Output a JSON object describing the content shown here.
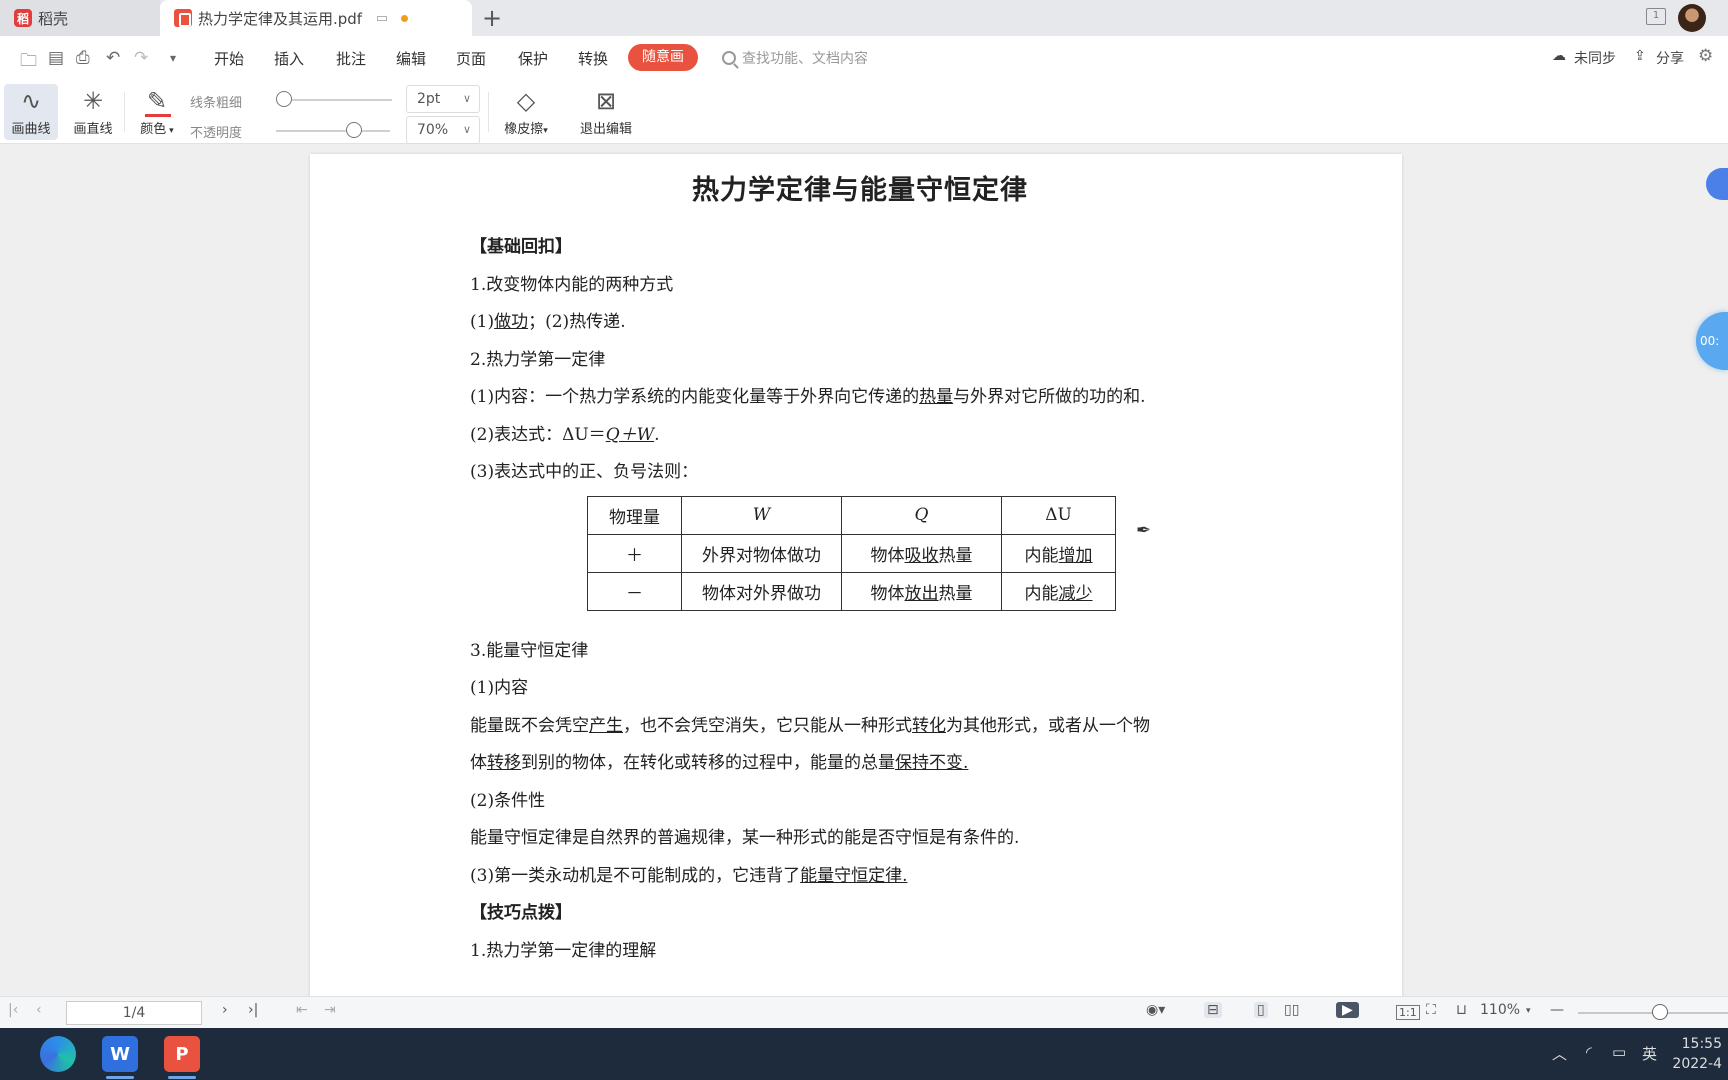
{
  "tabs": {
    "home_label": "稻壳",
    "doc_label": "热力学定律及其运用.pdf",
    "new_tab": "+"
  },
  "menu": {
    "items": [
      "开始",
      "插入",
      "批注",
      "编辑",
      "页面",
      "保护",
      "转换"
    ],
    "active": "随意画",
    "search_placeholder": "查找功能、文档内容",
    "sync": "未同步",
    "share": "分享"
  },
  "ink_toolbar": {
    "curve": "画曲线",
    "line": "画直线",
    "color": "颜色",
    "thickness_label": "线条粗细",
    "thickness_value": "2pt",
    "opacity_label": "不透明度",
    "opacity_value": "70%",
    "eraser": "橡皮擦",
    "exit": "退出编辑",
    "thickness_level": 0.0,
    "opacity_level": 0.7
  },
  "document": {
    "title": "热力学定律与能量守恒定律",
    "section_review": "【基础回扣】",
    "h1": "1.改变物体内能的两种方式",
    "h1_p1_a": "(1)",
    "h1_p1_b": "做功",
    "h1_p1_c": "；(2)",
    "h1_p1_d": "热传递",
    "h1_p1_e": ".",
    "h2": "2.热力学第一定律",
    "h2_p1_a": "(1)内容：一个热力学系统的内能变化量等于外界向它传递的",
    "h2_p1_b": "热量",
    "h2_p1_c": "与外界对它所做的功的和.",
    "h2_p2_a": "(2)表达式：ΔU＝",
    "h2_p2_b": "Q＋W",
    "h2_p2_c": ".",
    "h2_p3": "(3)表达式中的正、负号法则：",
    "table": {
      "headers": [
        "物理量",
        "W",
        "Q",
        "ΔU"
      ],
      "row_plus": {
        "sign": "＋",
        "w": "外界对物体做功",
        "q_a": "物体",
        "q_b": "吸收",
        "q_c": "热量",
        "u_a": "内能",
        "u_b": "增加"
      },
      "row_minus": {
        "sign": "－",
        "w": "物体对外界做功",
        "q_a": "物体",
        "q_b": "放出",
        "q_c": "热量",
        "u_a": "内能",
        "u_b": "减少"
      }
    },
    "h3": "3.能量守恒定律",
    "h3_p1": "(1)内容",
    "h3_p2_a": "能量既不会凭空",
    "h3_p2_b": "产生",
    "h3_p2_c": "，也不会凭空消失，它只能从一种形式",
    "h3_p2_d": "转化",
    "h3_p2_e": "为其他形式，或者从一个物",
    "h3_p3_a": "体",
    "h3_p3_b": "转移",
    "h3_p3_c": "到别的物体，在转化或转移的过程中，能量的总量",
    "h3_p3_d": "保持不变.",
    "h3_p4": "(2)条件性",
    "h3_p5": "能量守恒定律是自然界的普遍规律，某一种形式的能是否守恒是有条件的.",
    "h3_p6_a": "(3)第一类永动机是不可能制成的，它违背了",
    "h3_p6_b": "能量守恒定律.",
    "section_tips": "【技巧点拨】",
    "tips_h1": "1.热力学第一定律的理解"
  },
  "float": {
    "timer": "00:"
  },
  "status": {
    "page": "1/4",
    "zoom": "110%"
  },
  "taskbar": {
    "ime": "英",
    "time": "15:55",
    "date": "2022-4"
  }
}
